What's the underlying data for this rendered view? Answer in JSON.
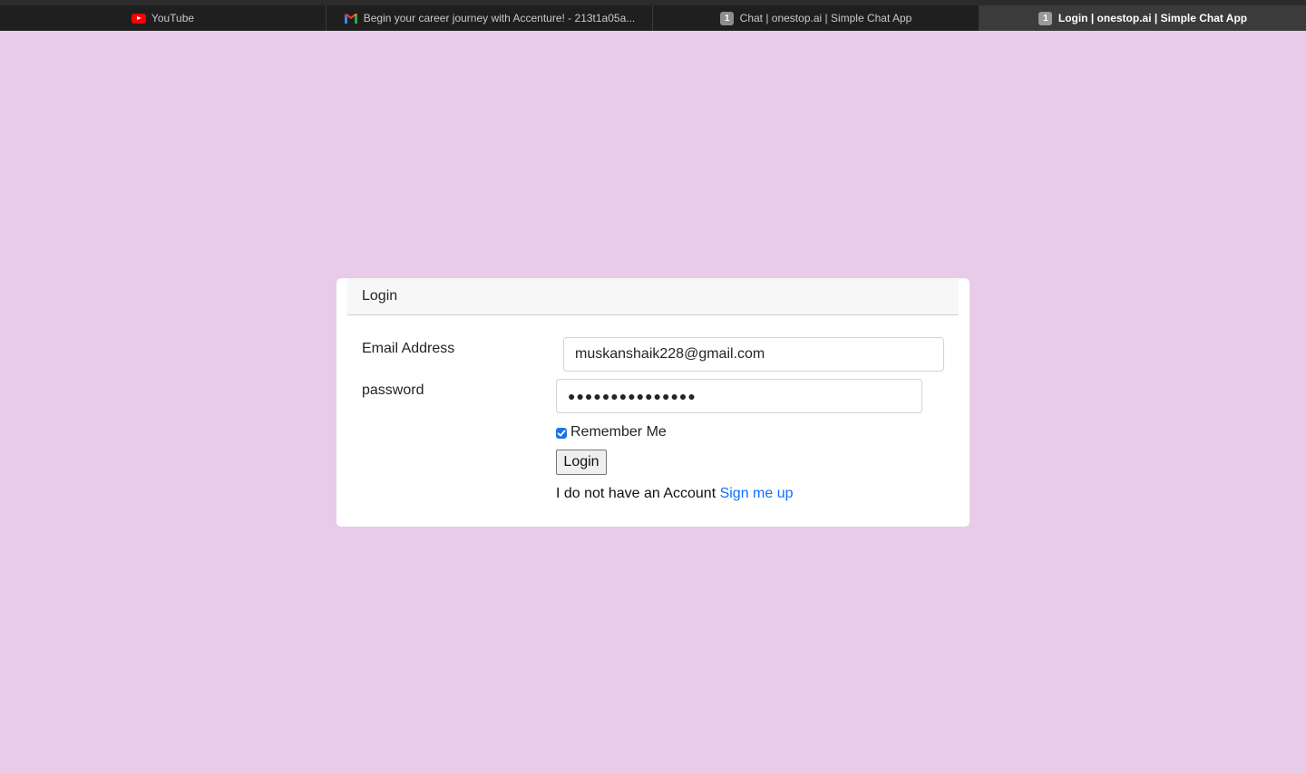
{
  "browser": {
    "tabs": [
      {
        "title": "YouTube",
        "icon": "youtube-icon",
        "active": false
      },
      {
        "title": "Begin your career journey with Accenture! - 213t1a05a...",
        "icon": "gmail-icon",
        "active": false
      },
      {
        "title": "Chat | onestop.ai | Simple Chat App",
        "icon": "number-badge-icon",
        "badge": "1",
        "active": false
      },
      {
        "title": "Login | onestop.ai | Simple Chat App",
        "icon": "number-badge-icon",
        "badge": "1",
        "active": true
      }
    ]
  },
  "login": {
    "header": "Login",
    "email_label": "Email Address",
    "email_value": "muskanshaik228@gmail.com",
    "password_label": "password",
    "password_mask": "●●●●●●●●●●●●●●●",
    "remember_label": "Remember Me",
    "remember_checked": true,
    "button_label": "Login",
    "no_account_text": "I do not have an Account ",
    "signup_link": "Sign me up"
  },
  "colors": {
    "page_background": "#e8cbe8",
    "link": "#0d6efd",
    "checkbox_accent": "#1a73e8"
  }
}
